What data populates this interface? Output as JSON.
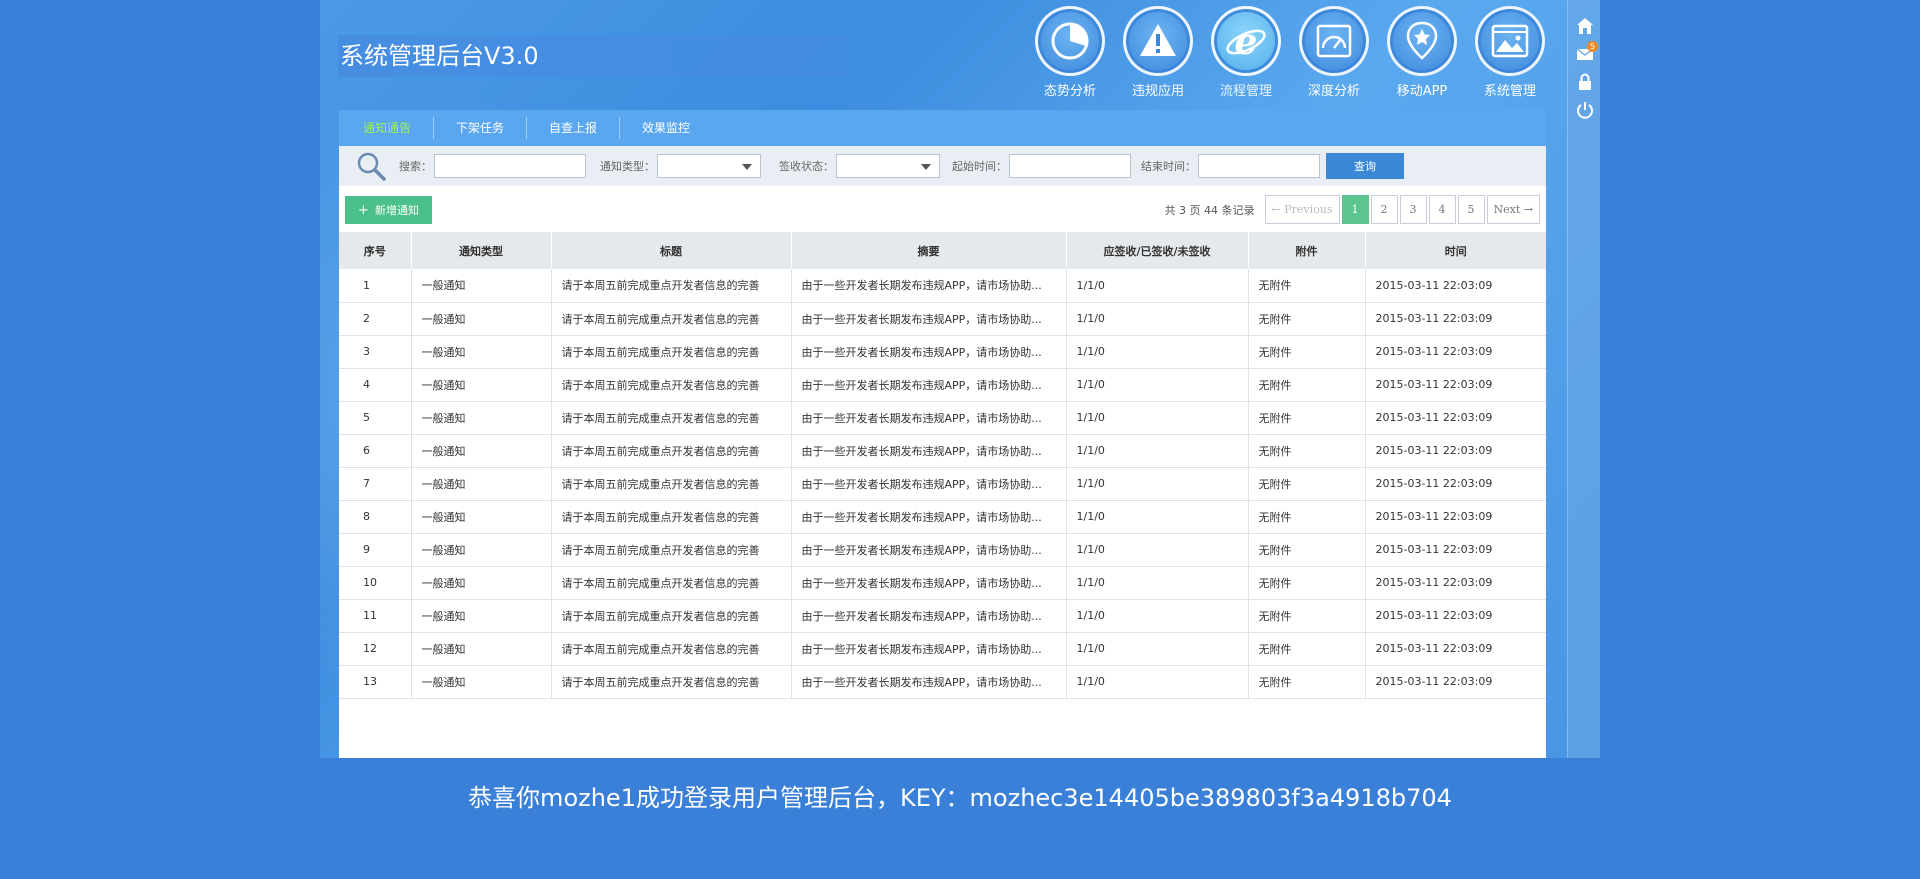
{
  "app": {
    "title": "系统管理后台V3.0"
  },
  "nav": [
    {
      "label": "态势分析",
      "icon": "pie-chart-icon",
      "active": false
    },
    {
      "label": "违规应用",
      "icon": "warning-icon",
      "active": false
    },
    {
      "label": "流程管理",
      "icon": "ie-browser-icon",
      "active": true
    },
    {
      "label": "深度分析",
      "icon": "gauge-icon",
      "active": false
    },
    {
      "label": "移动APP",
      "icon": "location-star-icon",
      "active": false
    },
    {
      "label": "系统管理",
      "icon": "image-window-icon",
      "active": false
    }
  ],
  "rail": {
    "mail_count": "5",
    "icons": [
      "home-icon",
      "mail-icon",
      "lock-icon",
      "power-icon"
    ]
  },
  "tabs": [
    {
      "label": "通知通告",
      "active": true
    },
    {
      "label": "下架任务",
      "active": false
    },
    {
      "label": "自查上报",
      "active": false
    },
    {
      "label": "效果监控",
      "active": false
    }
  ],
  "filters": {
    "search_label": "搜索：",
    "type_label": "通知类型：",
    "status_label": "签收状态：",
    "start_label": "起始时间：",
    "end_label": "结束时间：",
    "query_label": "查询"
  },
  "actions": {
    "add_label": "新增通知"
  },
  "pager": {
    "total_text": "共 3 页 44 条记录",
    "previous": "← Previous",
    "next": "Next →",
    "pages": [
      "1",
      "2",
      "3",
      "4",
      "5"
    ],
    "current": "1"
  },
  "table": {
    "headers": [
      "序号",
      "通知类型",
      "标题",
      "摘要",
      "应签收/已签收/未签收",
      "附件",
      "时间"
    ],
    "rows": [
      [
        "1",
        "一般通知",
        "请于本周五前完成重点开发者信息的完善",
        "由于一些开发者长期发布违规APP，请市场协助...",
        "1/1/0",
        "无附件",
        "2015-03-11 22:03:09"
      ],
      [
        "2",
        "一般通知",
        "请于本周五前完成重点开发者信息的完善",
        "由于一些开发者长期发布违规APP，请市场协助...",
        "1/1/0",
        "无附件",
        "2015-03-11 22:03:09"
      ],
      [
        "3",
        "一般通知",
        "请于本周五前完成重点开发者信息的完善",
        "由于一些开发者长期发布违规APP，请市场协助...",
        "1/1/0",
        "无附件",
        "2015-03-11 22:03:09"
      ],
      [
        "4",
        "一般通知",
        "请于本周五前完成重点开发者信息的完善",
        "由于一些开发者长期发布违规APP，请市场协助...",
        "1/1/0",
        "无附件",
        "2015-03-11 22:03:09"
      ],
      [
        "5",
        "一般通知",
        "请于本周五前完成重点开发者信息的完善",
        "由于一些开发者长期发布违规APP，请市场协助...",
        "1/1/0",
        "无附件",
        "2015-03-11 22:03:09"
      ],
      [
        "6",
        "一般通知",
        "请于本周五前完成重点开发者信息的完善",
        "由于一些开发者长期发布违规APP，请市场协助...",
        "1/1/0",
        "无附件",
        "2015-03-11 22:03:09"
      ],
      [
        "7",
        "一般通知",
        "请于本周五前完成重点开发者信息的完善",
        "由于一些开发者长期发布违规APP，请市场协助...",
        "1/1/0",
        "无附件",
        "2015-03-11 22:03:09"
      ],
      [
        "8",
        "一般通知",
        "请于本周五前完成重点开发者信息的完善",
        "由于一些开发者长期发布违规APP，请市场协助...",
        "1/1/0",
        "无附件",
        "2015-03-11 22:03:09"
      ],
      [
        "9",
        "一般通知",
        "请于本周五前完成重点开发者信息的完善",
        "由于一些开发者长期发布违规APP，请市场协助...",
        "1/1/0",
        "无附件",
        "2015-03-11 22:03:09"
      ],
      [
        "10",
        "一般通知",
        "请于本周五前完成重点开发者信息的完善",
        "由于一些开发者长期发布违规APP，请市场协助...",
        "1/1/0",
        "无附件",
        "2015-03-11 22:03:09"
      ],
      [
        "11",
        "一般通知",
        "请于本周五前完成重点开发者信息的完善",
        "由于一些开发者长期发布违规APP，请市场协助...",
        "1/1/0",
        "无附件",
        "2015-03-11 22:03:09"
      ],
      [
        "12",
        "一般通知",
        "请于本周五前完成重点开发者信息的完善",
        "由于一些开发者长期发布违规APP，请市场协助...",
        "1/1/0",
        "无附件",
        "2015-03-11 22:03:09"
      ],
      [
        "13",
        "一般通知",
        "请于本周五前完成重点开发者信息的完善",
        "由于一些开发者长期发布违规APP，请市场协助...",
        "1/1/0",
        "无附件",
        "2015-03-11 22:03:09"
      ]
    ]
  },
  "footer": {
    "welcome": "恭喜你mozhe1成功登录用户管理后台，KEY：mozhec3e14405be389803f3a4918b704"
  },
  "colors": {
    "page_bg": "#3a7fd8",
    "tab_bar": "#5ba7ef",
    "active_tab_text": "#9df05e",
    "add_button": "#4cc08a",
    "active_page": "#5cc48f",
    "query_button": "#3b88d8"
  }
}
